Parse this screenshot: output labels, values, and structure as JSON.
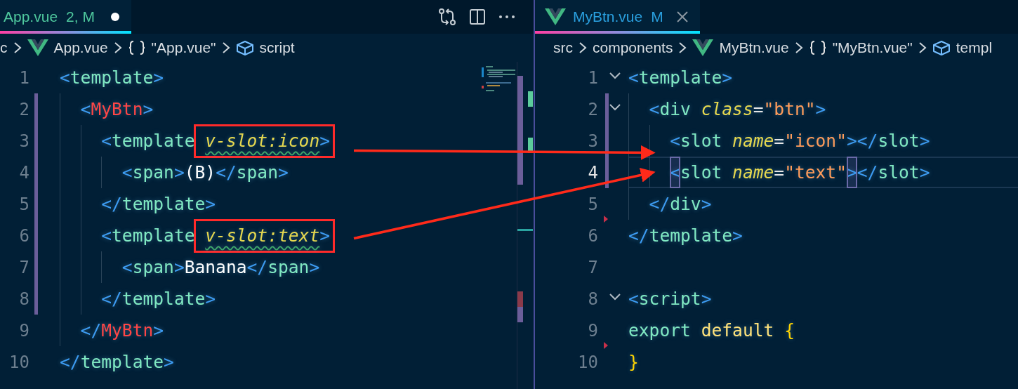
{
  "left_pane": {
    "tab": {
      "label": "App.vue",
      "badge": "2, M",
      "icon": false,
      "dirty": true,
      "selected": true,
      "kind": "warning"
    },
    "actions": [
      {
        "kind": "compare"
      },
      {
        "kind": "split"
      },
      {
        "kind": "more"
      }
    ],
    "breadcrumbs": [
      {
        "kind": "folder",
        "label": "c"
      },
      {
        "kind": "vue",
        "label": "App.vue"
      },
      {
        "kind": "object",
        "label": "\"App.vue\""
      },
      {
        "kind": "element",
        "label": "script"
      }
    ],
    "lines": [
      {
        "number": "1",
        "modified": false,
        "fold": false,
        "current": false,
        "deleted_above": false,
        "tokens": [
          {
            "kind": "p",
            "t": "<"
          },
          {
            "kind": "tag",
            "t": "template"
          },
          {
            "kind": "p",
            "t": ">"
          }
        ],
        "children": [
          {
            "number": "2",
            "modified": true,
            "fold": false,
            "current": false,
            "deleted_above": false,
            "tokens": [
              {
                "kind": "p",
                "t": "<"
              },
              {
                "kind": "comp",
                "t": "MyBtn"
              },
              {
                "kind": "p",
                "t": ">"
              }
            ],
            "children": [
              {
                "number": "3",
                "modified": true,
                "fold": false,
                "current": false,
                "deleted_above": false,
                "tokens": [
                  {
                    "kind": "p",
                    "t": "<"
                  },
                  {
                    "kind": "tag",
                    "t": "template "
                  },
                  {
                    "kind": "box",
                    "tokens": [
                      {
                        "kind": "attr",
                        "t": "v-slot:icon",
                        "squiggle": true
                      },
                      {
                        "kind": "p",
                        "t": ">",
                        "squiggle": false
                      }
                    ]
                  }
                ],
                "children": [
                  {
                    "number": "4",
                    "modified": true,
                    "fold": false,
                    "current": false,
                    "deleted_above": false,
                    "tokens": [
                      {
                        "kind": "p",
                        "t": "<"
                      },
                      {
                        "kind": "tag",
                        "t": "span"
                      },
                      {
                        "kind": "p",
                        "t": ">"
                      },
                      {
                        "kind": "text",
                        "t": "(B)"
                      },
                      {
                        "kind": "p",
                        "t": "</"
                      },
                      {
                        "kind": "tag",
                        "t": "span"
                      },
                      {
                        "kind": "p",
                        "t": ">"
                      }
                    ]
                  }
                ]
              },
              {
                "number": "5",
                "modified": true,
                "fold": false,
                "current": false,
                "deleted_above": false,
                "tokens": [
                  {
                    "kind": "p",
                    "t": "</"
                  },
                  {
                    "kind": "tag",
                    "t": "template"
                  },
                  {
                    "kind": "p",
                    "t": ">"
                  }
                ]
              },
              {
                "number": "6",
                "modified": true,
                "fold": false,
                "current": false,
                "deleted_above": false,
                "tokens": [
                  {
                    "kind": "p",
                    "t": "<"
                  },
                  {
                    "kind": "tag",
                    "t": "template "
                  },
                  {
                    "kind": "box",
                    "tokens": [
                      {
                        "kind": "attr",
                        "t": "v-slot:text",
                        "squiggle": true
                      },
                      {
                        "kind": "p",
                        "t": ">",
                        "squiggle": false
                      }
                    ]
                  }
                ],
                "children": [
                  {
                    "number": "7",
                    "modified": true,
                    "fold": false,
                    "current": false,
                    "deleted_above": false,
                    "tokens": [
                      {
                        "kind": "p",
                        "t": "<"
                      },
                      {
                        "kind": "tag",
                        "t": "span"
                      },
                      {
                        "kind": "p",
                        "t": ">"
                      },
                      {
                        "kind": "text",
                        "t": "Banana"
                      },
                      {
                        "kind": "p",
                        "t": "</"
                      },
                      {
                        "kind": "tag",
                        "t": "span"
                      },
                      {
                        "kind": "p",
                        "t": ">"
                      }
                    ]
                  }
                ]
              },
              {
                "number": "8",
                "modified": true,
                "fold": false,
                "current": false,
                "deleted_above": false,
                "tokens": [
                  {
                    "kind": "p",
                    "t": "</"
                  },
                  {
                    "kind": "tag",
                    "t": "template"
                  },
                  {
                    "kind": "p",
                    "t": ">"
                  }
                ]
              }
            ]
          },
          {
            "number": "9",
            "modified": false,
            "fold": false,
            "current": false,
            "deleted_above": false,
            "tokens": [
              {
                "kind": "p",
                "t": "</"
              },
              {
                "kind": "comp",
                "t": "MyBtn"
              },
              {
                "kind": "p",
                "t": ">"
              }
            ]
          }
        ]
      },
      {
        "number": "10",
        "modified": false,
        "fold": false,
        "current": false,
        "deleted_above": false,
        "tokens": [
          {
            "kind": "p",
            "t": "</"
          },
          {
            "kind": "tag",
            "t": "template"
          },
          {
            "kind": "p",
            "t": ">"
          }
        ]
      }
    ]
  },
  "right_pane": {
    "tab": {
      "label": "MyBtn.vue",
      "badge": "M",
      "icon": true,
      "dirty": false,
      "selected": true,
      "kind": "modified"
    },
    "breadcrumbs": [
      {
        "kind": "folder",
        "label": "src"
      },
      {
        "kind": "folder",
        "label": "components"
      },
      {
        "kind": "vue",
        "label": "MyBtn.vue"
      },
      {
        "kind": "object",
        "label": "\"MyBtn.vue\""
      },
      {
        "kind": "element",
        "label": "templ"
      }
    ],
    "lines": [
      {
        "number": "1",
        "modified": false,
        "fold": true,
        "current": false,
        "deleted_above": false,
        "tokens": [
          {
            "kind": "p",
            "t": "<"
          },
          {
            "kind": "tag",
            "t": "template"
          },
          {
            "kind": "p",
            "t": ">"
          }
        ],
        "children": [
          {
            "number": "2",
            "modified": true,
            "fold": true,
            "current": false,
            "deleted_above": false,
            "tokens": [
              {
                "kind": "p",
                "t": "<"
              },
              {
                "kind": "tag",
                "t": "div "
              },
              {
                "kind": "attr",
                "t": "class"
              },
              {
                "kind": "eq",
                "t": "="
              },
              {
                "kind": "str",
                "t": "\"btn\""
              },
              {
                "kind": "p",
                "t": ">"
              }
            ],
            "children": [
              {
                "number": "3",
                "modified": true,
                "fold": false,
                "current": false,
                "deleted_above": false,
                "tokens": [
                  {
                    "kind": "p",
                    "t": "<"
                  },
                  {
                    "kind": "tag",
                    "t": "slot "
                  },
                  {
                    "kind": "attr",
                    "t": "name"
                  },
                  {
                    "kind": "eq",
                    "t": "="
                  },
                  {
                    "kind": "str",
                    "t": "\"icon\""
                  },
                  {
                    "kind": "p",
                    "t": "></"
                  },
                  {
                    "kind": "tag",
                    "t": "slot"
                  },
                  {
                    "kind": "p",
                    "t": ">"
                  }
                ]
              },
              {
                "number": "4",
                "modified": true,
                "fold": false,
                "current": true,
                "deleted_above": false,
                "tokens": [
                  {
                    "kind": "p",
                    "t": "<",
                    "matched": true
                  },
                  {
                    "kind": "tag",
                    "t": "slot "
                  },
                  {
                    "kind": "attr",
                    "t": "name"
                  },
                  {
                    "kind": "eq",
                    "t": "="
                  },
                  {
                    "kind": "str",
                    "t": "\"text\""
                  },
                  {
                    "kind": "p",
                    "t": ">",
                    "matched": true
                  },
                  {
                    "kind": "p",
                    "t": "</"
                  },
                  {
                    "kind": "tag",
                    "t": "slot"
                  },
                  {
                    "kind": "p",
                    "t": ">"
                  }
                ]
              }
            ]
          },
          {
            "number": "5",
            "modified": false,
            "fold": false,
            "current": false,
            "deleted_above": false,
            "tokens": [
              {
                "kind": "p",
                "t": "</"
              },
              {
                "kind": "tag",
                "t": "div"
              },
              {
                "kind": "p",
                "t": ">"
              }
            ]
          }
        ]
      },
      {
        "number": "6",
        "modified": false,
        "fold": false,
        "current": false,
        "deleted_above": true,
        "tokens": [
          {
            "kind": "p",
            "t": "</"
          },
          {
            "kind": "tag",
            "t": "template"
          },
          {
            "kind": "p",
            "t": ">"
          }
        ]
      },
      {
        "number": "7",
        "modified": false,
        "fold": false,
        "current": false,
        "deleted_above": false
      },
      {
        "number": "8",
        "modified": false,
        "fold": true,
        "current": false,
        "deleted_above": false,
        "tokens": [
          {
            "kind": "p",
            "t": "<"
          },
          {
            "kind": "tag",
            "t": "script"
          },
          {
            "kind": "p",
            "t": ">"
          }
        ]
      },
      {
        "number": "9",
        "modified": false,
        "fold": false,
        "current": false,
        "deleted_above": false,
        "tokens": [
          {
            "kind": "kw",
            "t": "export "
          },
          {
            "kind": "kw2",
            "t": "default "
          },
          {
            "kind": "brace",
            "t": "{"
          }
        ]
      },
      {
        "number": "10",
        "modified": false,
        "fold": false,
        "current": false,
        "deleted_above": true,
        "tokens": [
          {
            "kind": "brace",
            "t": "}"
          }
        ]
      }
    ]
  }
}
